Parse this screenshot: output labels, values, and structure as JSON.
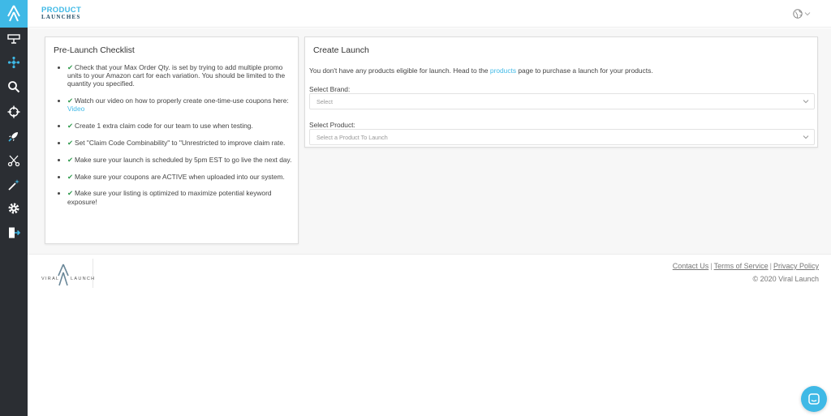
{
  "header": {
    "brand_top": "PRODUCT",
    "brand_bottom": "LAUNCHES"
  },
  "sidebar": {
    "items": [
      {
        "icon": "monitor-icon"
      },
      {
        "icon": "network-icon"
      },
      {
        "icon": "search-icon"
      },
      {
        "icon": "crosshair-icon"
      },
      {
        "icon": "rocket-icon"
      },
      {
        "icon": "scissors-icon"
      },
      {
        "icon": "magic-wand-icon"
      },
      {
        "icon": "gear-icon"
      },
      {
        "icon": "logout-icon"
      }
    ]
  },
  "checklist": {
    "title": "Pre-Launch Checklist",
    "items": [
      {
        "text": "Check that your Max Order Qty. is set by trying to add multiple promo units to your Amazon cart for each variation. You should be limited to the quantity you specified."
      },
      {
        "text": "Watch our video on how to properly create one-time-use coupons here: ",
        "link": "Video"
      },
      {
        "text": "Create 1 extra claim code for our team to use when testing."
      },
      {
        "text": "Set \"Claim Code Combinability\" to \"Unrestricted to improve claim rate."
      },
      {
        "text": "Make sure your launch is scheduled by 5pm EST to go live the next day."
      },
      {
        "text": "Make sure your coupons are ACTIVE when uploaded into our system."
      },
      {
        "text": "Make sure your listing is optimized to maximize potential keyword exposure!"
      }
    ]
  },
  "create_launch": {
    "title": "Create Launch",
    "info_before": "You don't have any products eligible for launch. Head to the ",
    "info_link": "products",
    "info_after": " page to purchase a launch for your products.",
    "brand_label": "Select Brand:",
    "brand_placeholder": "Select",
    "product_label": "Select Product:",
    "product_placeholder": "Select a Product To Launch"
  },
  "footer": {
    "logo_left": "VIRAL",
    "logo_right": "LAUNCH",
    "links": [
      "Contact Us",
      "Terms of Service",
      "Privacy Policy"
    ],
    "separator": "|",
    "copyright": "© 2020 Viral Launch"
  },
  "colors": {
    "accent": "#3fb9e6",
    "sidebar": "#2b2e33",
    "check": "#2e9a4c"
  }
}
